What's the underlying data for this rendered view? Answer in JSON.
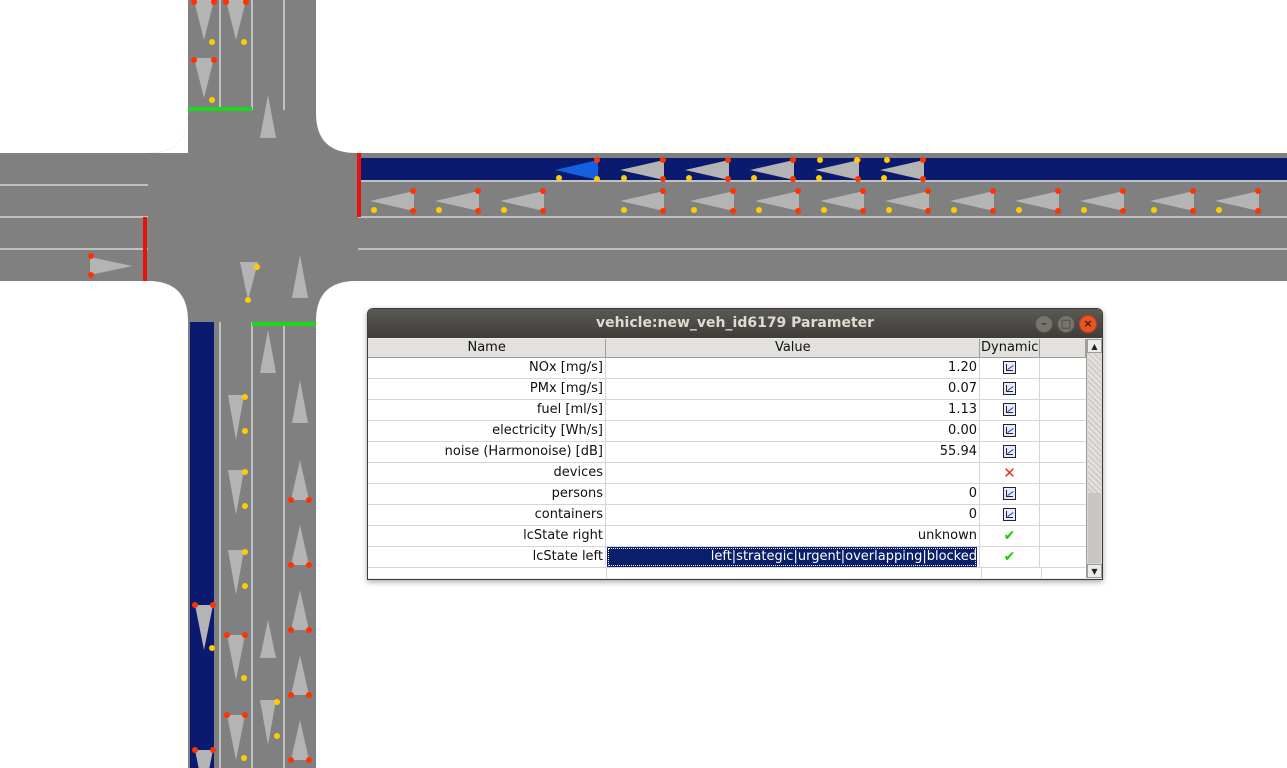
{
  "window": {
    "title": "vehicle:new_veh_id6179 Parameter",
    "buttons": {
      "minimize": "–",
      "maximize": "□",
      "close": "×"
    }
  },
  "table": {
    "columns": [
      "Name",
      "Value",
      "Dynamic"
    ],
    "rows": [
      {
        "name": "NOx [mg/s]",
        "value": "1.20",
        "dynamic": "chart-icon"
      },
      {
        "name": "PMx [mg/s]",
        "value": "0.07",
        "dynamic": "chart-icon"
      },
      {
        "name": "fuel [ml/s]",
        "value": "1.13",
        "dynamic": "chart-icon"
      },
      {
        "name": "electricity [Wh/s]",
        "value": "0.00",
        "dynamic": "chart-icon"
      },
      {
        "name": "noise (Harmonoise) [dB]",
        "value": "55.94",
        "dynamic": "chart-icon"
      },
      {
        "name": "devices",
        "value": "",
        "dynamic": "x-icon"
      },
      {
        "name": "persons",
        "value": "0",
        "dynamic": "chart-icon"
      },
      {
        "name": "containers",
        "value": "0",
        "dynamic": "chart-icon"
      },
      {
        "name": "lcState right",
        "value": "unknown",
        "dynamic": "check-icon"
      },
      {
        "name": "lcState left",
        "value": "left|strategic|urgent|overlapping|blocked",
        "dynamic": "check-icon",
        "selected": true
      }
    ]
  },
  "colors": {
    "road": "#808080",
    "bus_lane": "#0a1a6e",
    "vehicle": "#b4b4b4",
    "signal_red": "#e8130f",
    "signal_green": "#1ed51e",
    "blinker": "#ffcc00",
    "brake": "#ff3300",
    "selection": "#0a1f6b"
  },
  "scrollbar": {
    "up_arrow": "▲",
    "down_arrow": "▼"
  }
}
